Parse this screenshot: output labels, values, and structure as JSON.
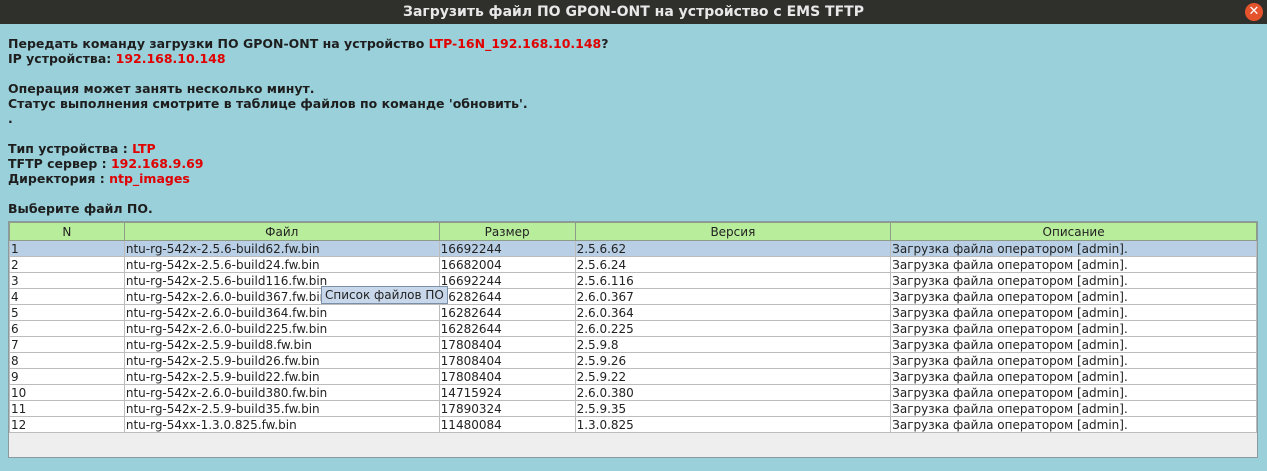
{
  "window": {
    "title": "Загрузить файл ПО GPON-ONT на устройство с EMS TFTP",
    "close_glyph": "✕"
  },
  "message": {
    "question_prefix": "Передать команду загрузки ПО GPON-ONT на устройство ",
    "device_name": "LTP-16N_192.168.10.148",
    "question_suffix": "?",
    "ip_label": "IP устройства: ",
    "ip_value": "192.168.10.148",
    "note_line1": "Операция может занять несколько минут.",
    "note_line2": "Статус выполнения смотрите в таблице файлов по команде 'обновить'.",
    "note_line3": ".",
    "type_label": "Тип устройства : ",
    "type_value": "LTP",
    "tftp_label": "TFTP сервер : ",
    "tftp_value": "192.168.9.69",
    "dir_label": "Директория : ",
    "dir_value": "ntp_images",
    "choose_label": "Выберите файл ПО."
  },
  "table": {
    "columns": [
      "N",
      "Файл",
      "Размер",
      "Версия",
      "Описание"
    ],
    "rows": [
      [
        "1",
        "ntu-rg-542x-2.5.6-build62.fw.bin",
        "16692244",
        "2.5.6.62",
        "Загрузка файла оператором [admin]."
      ],
      [
        "2",
        "ntu-rg-542x-2.5.6-build24.fw.bin",
        "16682004",
        "2.5.6.24",
        "Загрузка файла оператором [admin]."
      ],
      [
        "3",
        "ntu-rg-542x-2.5.6-build116.fw.bin",
        "16692244",
        "2.5.6.116",
        "Загрузка файла оператором [admin]."
      ],
      [
        "4",
        "ntu-rg-542x-2.6.0-build367.fw.bin",
        "16282644",
        "2.6.0.367",
        "Загрузка файла оператором [admin]."
      ],
      [
        "5",
        "ntu-rg-542x-2.6.0-build364.fw.bin",
        "16282644",
        "2.6.0.364",
        "Загрузка файла оператором [admin]."
      ],
      [
        "6",
        "ntu-rg-542x-2.6.0-build225.fw.bin",
        "16282644",
        "2.6.0.225",
        "Загрузка файла оператором [admin]."
      ],
      [
        "7",
        "ntu-rg-542x-2.5.9-build8.fw.bin",
        "17808404",
        "2.5.9.8",
        "Загрузка файла оператором [admin]."
      ],
      [
        "8",
        "ntu-rg-542x-2.5.9-build26.fw.bin",
        "17808404",
        "2.5.9.26",
        "Загрузка файла оператором [admin]."
      ],
      [
        "9",
        "ntu-rg-542x-2.5.9-build22.fw.bin",
        "17808404",
        "2.5.9.22",
        "Загрузка файла оператором [admin]."
      ],
      [
        "10",
        "ntu-rg-542x-2.6.0-build380.fw.bin",
        "14715924",
        "2.6.0.380",
        "Загрузка файла оператором [admin]."
      ],
      [
        "11",
        "ntu-rg-542x-2.5.9-build35.fw.bin",
        "17890324",
        "2.5.9.35",
        "Загрузка файла оператором [admin]."
      ],
      [
        "12",
        "ntu-rg-54xx-1.3.0.825.fw.bin",
        "11480084",
        "1.3.0.825",
        "Загрузка файла оператором [admin]."
      ]
    ],
    "selected_row": 1,
    "tooltip": "Список файлов ПО"
  }
}
